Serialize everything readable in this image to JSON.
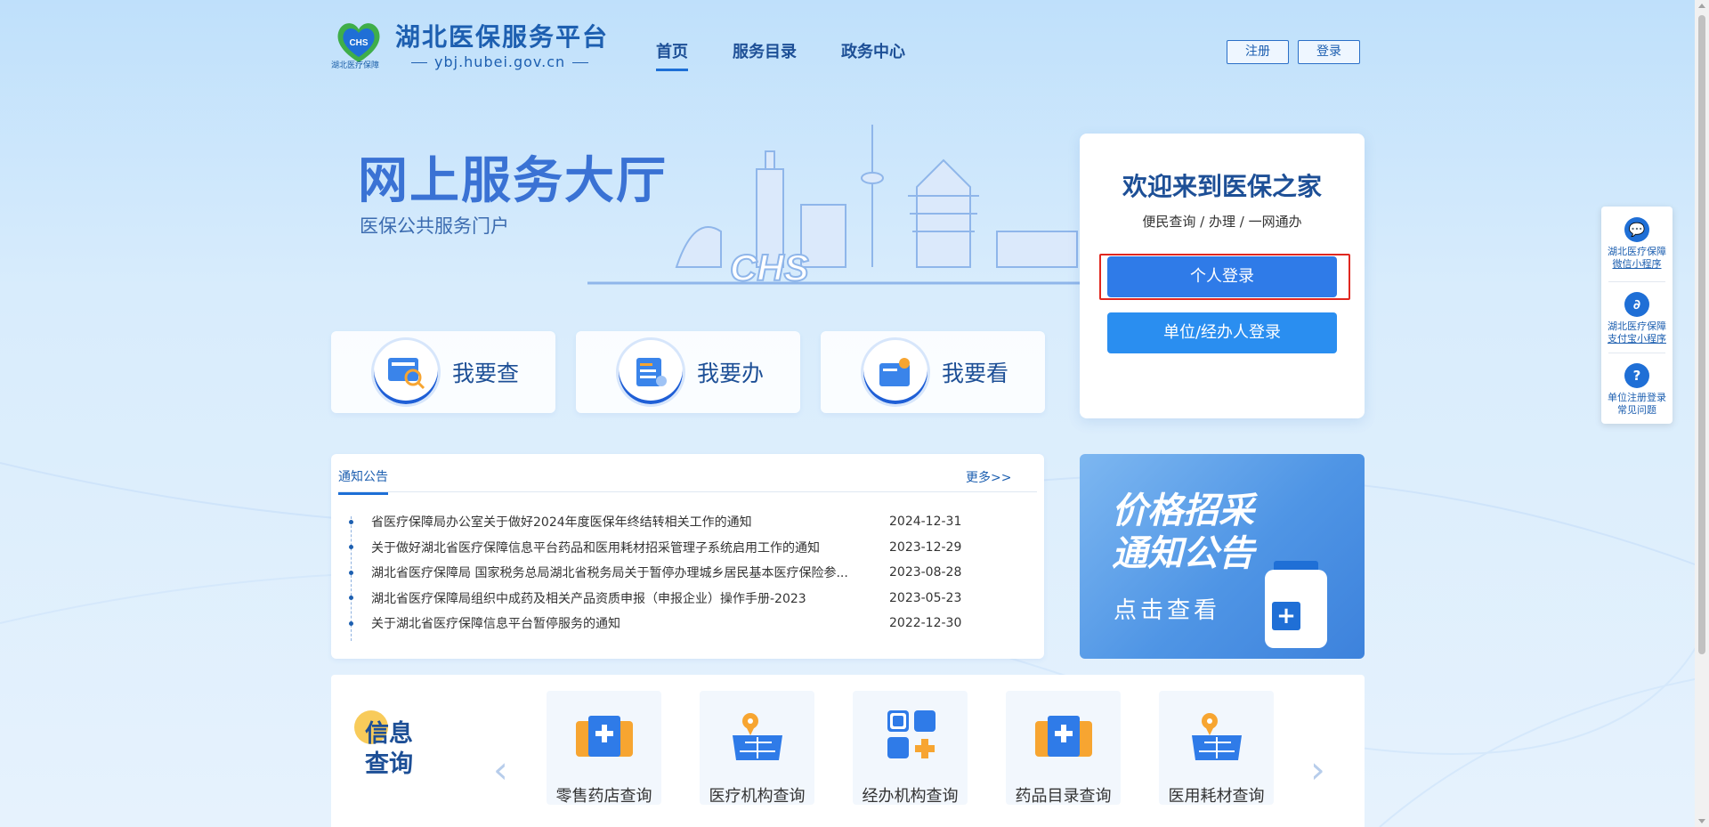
{
  "header": {
    "site_name": "湖北医保服务平台",
    "site_domain": "ybj.hubei.gov.cn",
    "logo_caption": "湖北医疗保障",
    "nav": [
      {
        "label": "首页",
        "active": true
      },
      {
        "label": "服务目录",
        "active": false
      },
      {
        "label": "政务中心",
        "active": false
      }
    ],
    "register_label": "注册",
    "login_label": "登录"
  },
  "hero": {
    "title": "网上服务大厅",
    "subtitle": "医保公共服务门户"
  },
  "tiles": [
    {
      "label": "我要查",
      "icon": "search-doc-icon"
    },
    {
      "label": "我要办",
      "icon": "handle-doc-icon"
    },
    {
      "label": "我要看",
      "icon": "view-folder-icon"
    }
  ],
  "login_card": {
    "title": "欢迎来到医保之家",
    "subtitle": "便民查询 / 办理 / 一网通办",
    "personal_login": "个人登录",
    "unit_login": "单位/经办人登录"
  },
  "side_float": [
    {
      "line1": "湖北医疗保障",
      "line2": "微信小程序",
      "icon": "wechat-icon"
    },
    {
      "line1": "湖北医疗保障",
      "line2": "支付宝小程序",
      "icon": "alipay-mini-icon"
    },
    {
      "line1": "单位注册登录",
      "line2": "常见问题",
      "icon": "question-icon"
    }
  ],
  "notices": {
    "tab_label": "通知公告",
    "more_label": "更多>>",
    "items": [
      {
        "title": "省医疗保障局办公室关于做好2024年度医保年终结转相关工作的通知",
        "date": "2024-12-31"
      },
      {
        "title": "关于做好湖北省医疗保障信息平台药品和医用耗材招采管理子系统启用工作的通知",
        "date": "2023-12-29"
      },
      {
        "title": "湖北省医疗保障局 国家税务总局湖北省税务局关于暂停办理城乡居民基本医疗保险参...",
        "date": "2023-08-28"
      },
      {
        "title": "湖北省医疗保障局组织中成药及相关产品资质申报（申报企业）操作手册-2023",
        "date": "2023-05-23"
      },
      {
        "title": "关于湖北省医疗保障信息平台暂停服务的通知",
        "date": "2022-12-30"
      }
    ]
  },
  "price_banner": {
    "title_line1": "价格招采",
    "title_line2": "通知公告",
    "subtitle": "点击查看"
  },
  "info_query": {
    "title_line1": "信息",
    "title_line2": "查询",
    "prev_label": "‹",
    "next_label": "›",
    "cards": [
      {
        "label": "零售药店查询",
        "icon": "pharmacy-icon"
      },
      {
        "label": "医疗机构查询",
        "icon": "hospital-map-icon"
      },
      {
        "label": "经办机构查询",
        "icon": "agency-grid-icon"
      },
      {
        "label": "药品目录查询",
        "icon": "drug-catalog-icon"
      },
      {
        "label": "医用耗材查询",
        "icon": "consumables-map-icon"
      }
    ]
  },
  "colors": {
    "primary": "#1d5fb0",
    "button_blue": "#2f7be8",
    "highlight_red": "#e0271f",
    "accent_orange": "#f7a531"
  }
}
